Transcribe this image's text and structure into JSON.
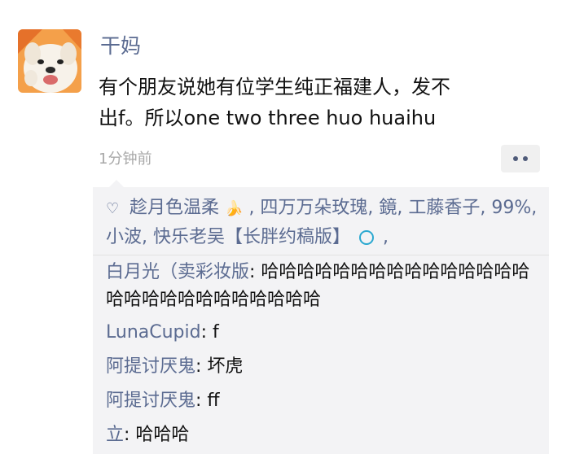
{
  "post": {
    "author": "干妈",
    "text_line1": "有个朋友说她有位学生纯正福建人，发不",
    "text_line2": "出f。所以one two three huo huaihu",
    "time": "1分钟前"
  },
  "likes": {
    "part1": "趁月色温柔",
    "part2": ", 四万万朵玫瑰, 鏡, 工藤香子, 99%, 小波, 快乐老吴【长胖约稿版】",
    "part3": ","
  },
  "comments": [
    {
      "name": "白月光（卖彩妆版",
      "sep": ": ",
      "text": "哈哈哈哈哈哈哈哈哈哈哈哈哈哈哈哈哈哈哈哈哈哈哈哈哈哈哈"
    },
    {
      "name": "LunaCupid",
      "sep": ": ",
      "text": "f"
    },
    {
      "name": "阿提讨厌鬼",
      "sep": ": ",
      "text": "坏虎"
    },
    {
      "name": "阿提讨厌鬼",
      "sep": ": ",
      "text": "ff"
    },
    {
      "name": "立",
      "sep": ": ",
      "text": "哈哈哈"
    }
  ],
  "colors": {
    "name_link": "#5b6b91",
    "time": "#a8a8a8",
    "panel_bg": "#f3f3f5"
  },
  "icons": {
    "like": "heart-outline-icon",
    "emoji": "banana-emoji-icon",
    "more": "more-dots-icon"
  }
}
